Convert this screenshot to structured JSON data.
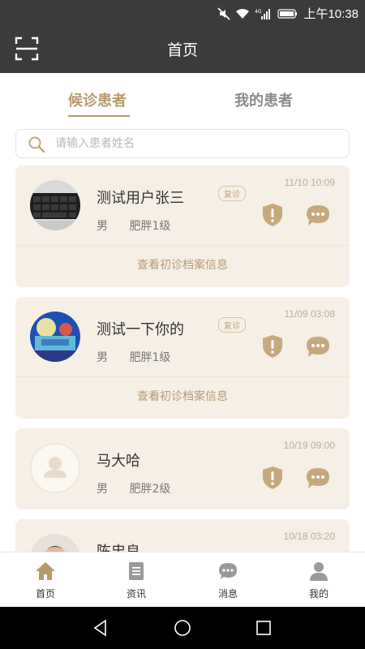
{
  "status": {
    "time": "上午10:38",
    "icons": [
      "mute-icon",
      "wifi-icon",
      "signal-4g-icon",
      "battery-icon"
    ]
  },
  "header": {
    "title": "首页",
    "scan_icon": "scan-icon"
  },
  "tabs": [
    {
      "label": "候诊患者",
      "active": true
    },
    {
      "label": "我的患者",
      "active": false
    }
  ],
  "search": {
    "placeholder": "请输入患者姓名",
    "value": ""
  },
  "patients": [
    {
      "name": "测试用户张三",
      "gender": "男",
      "condition": "肥胖1级",
      "badge": "复诊",
      "time": "11/10 10:09",
      "link": "查看初诊档案信息"
    },
    {
      "name": "测试一下你的",
      "gender": "男",
      "condition": "肥胖1级",
      "badge": "复诊",
      "time": "11/09 03:08",
      "link": "查看初诊档案信息"
    },
    {
      "name": "马大哈",
      "gender": "男",
      "condition": "肥胖2级",
      "time": "10/19 09:00"
    },
    {
      "name": "陈忠良",
      "time": "10/18 03:20"
    }
  ],
  "bottom_nav": [
    {
      "label": "首页",
      "icon": "home-icon",
      "active": true
    },
    {
      "label": "资讯",
      "icon": "news-icon",
      "active": false
    },
    {
      "label": "消息",
      "icon": "message-icon",
      "active": false
    },
    {
      "label": "我的",
      "icon": "profile-icon",
      "active": false
    }
  ],
  "colors": {
    "accent": "#b79b6b",
    "card_bg": "#f6efe6",
    "header_bg": "#3d3b3a"
  }
}
